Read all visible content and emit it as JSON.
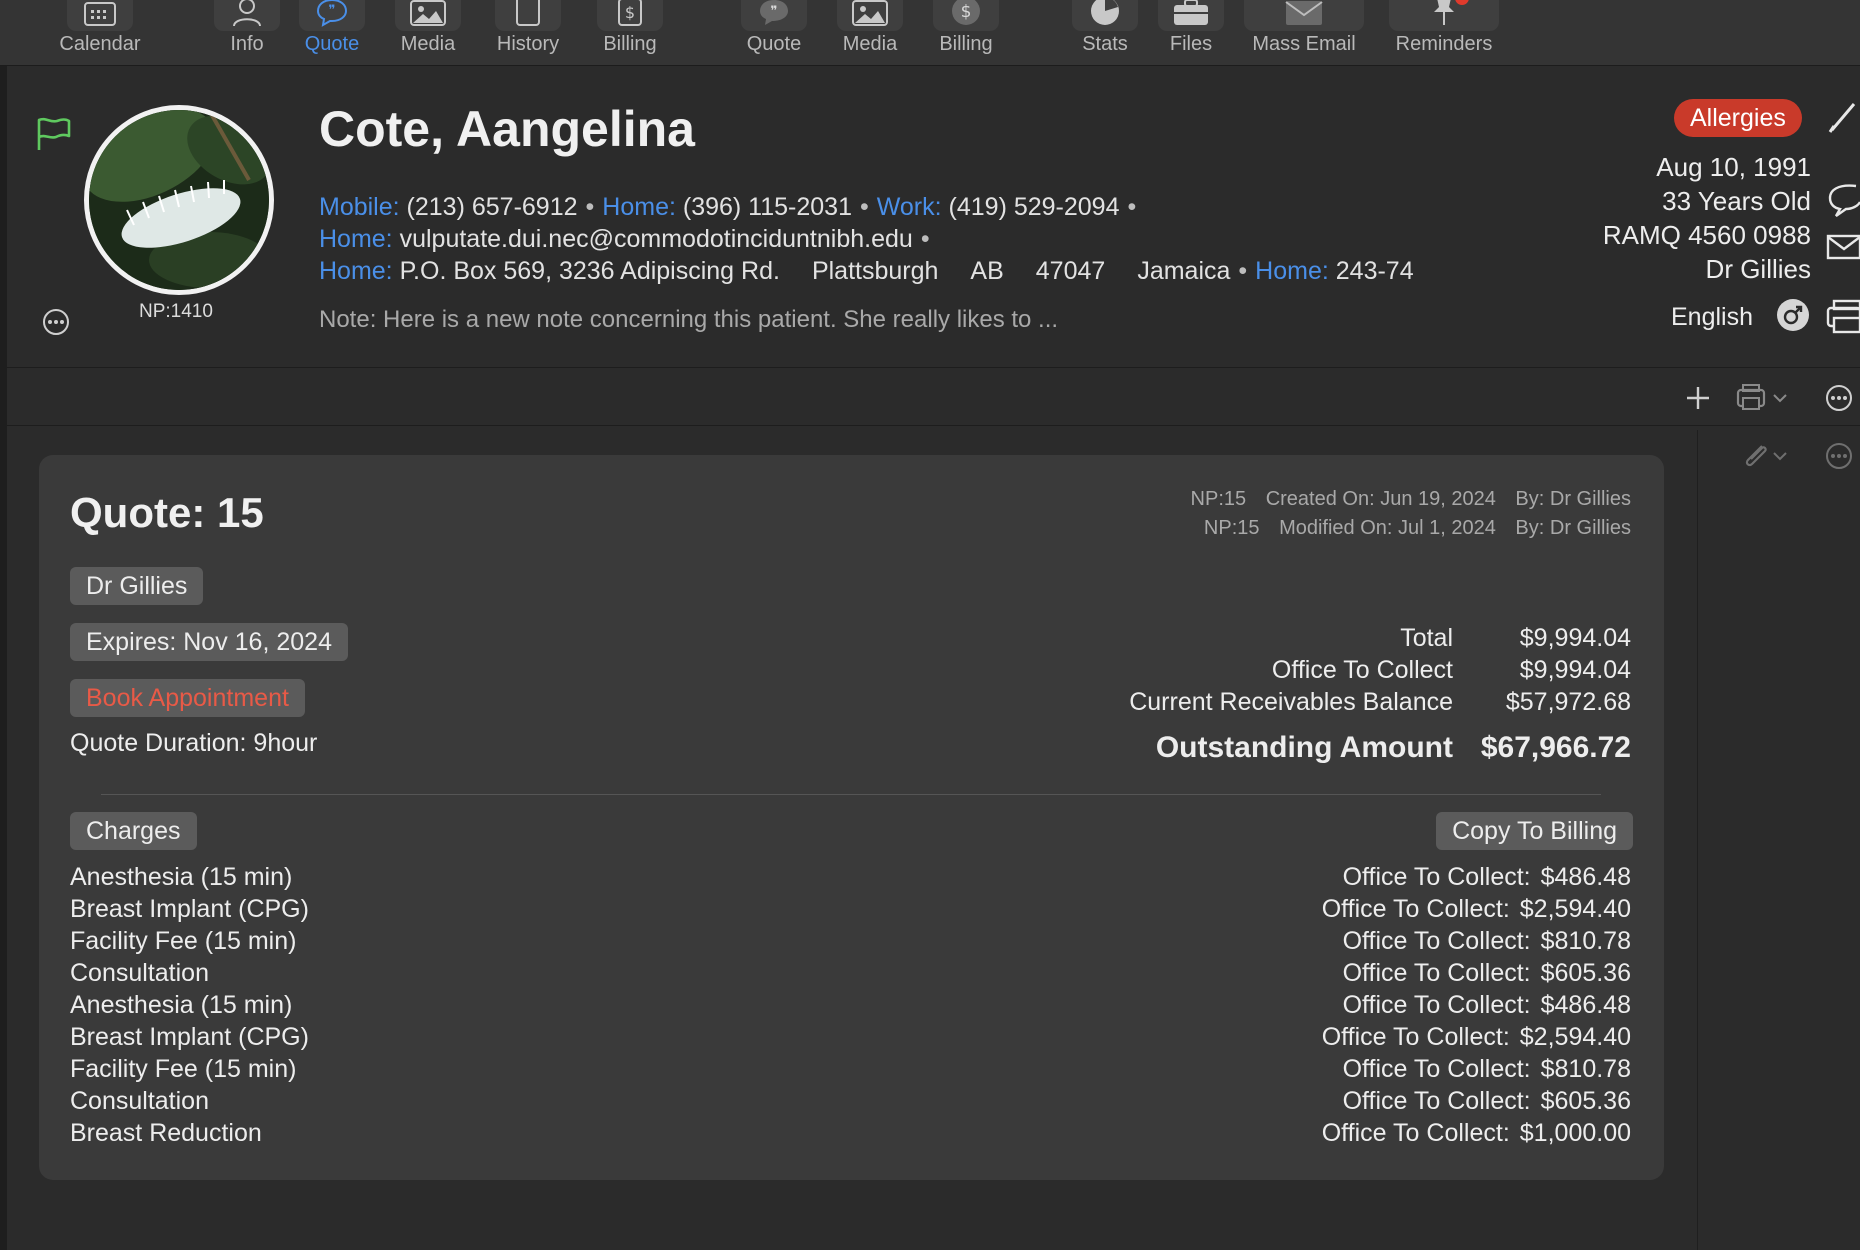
{
  "toolbar": {
    "items": [
      {
        "label": "Calendar",
        "icon": "calendar-icon"
      },
      {
        "label": "Info",
        "icon": "person-icon"
      },
      {
        "label": "Quote",
        "icon": "quote-icon",
        "active": true
      },
      {
        "label": "Media",
        "icon": "photo-icon"
      },
      {
        "label": "History",
        "icon": "history-icon"
      },
      {
        "label": "Billing",
        "icon": "dollar-doc-icon"
      },
      {
        "label": "Quote",
        "icon": "quote-bubble-icon"
      },
      {
        "label": "Media",
        "icon": "photo-icon"
      },
      {
        "label": "Billing",
        "icon": "dollar-circle-icon"
      },
      {
        "label": "Stats",
        "icon": "pie-chart-icon"
      },
      {
        "label": "Files",
        "icon": "briefcase-icon"
      },
      {
        "label": "Mass Email",
        "icon": "envelope-icon"
      },
      {
        "label": "Reminders",
        "icon": "pin-icon"
      }
    ]
  },
  "patient": {
    "name": "Cote, Aangelina",
    "np": "NP:1410",
    "mobile_label": "Mobile:",
    "mobile": "(213) 657-6912",
    "home_label": "Home:",
    "home_phone": "(396) 115-2031",
    "work_label": "Work:",
    "work_phone": "(419) 529-2094",
    "email_label": "Home:",
    "email": "vulputate.dui.nec@commodotinciduntnibh.edu",
    "address_label": "Home:",
    "address_street": "P.O. Box 569, 3236 Adipiscing Rd.",
    "address_city": "Plattsburgh",
    "address_region": "AB",
    "address_zip": "47047",
    "address_country": "Jamaica",
    "extra_label": "Home:",
    "extra_phone": "243-74",
    "bullet": "•",
    "note": "Note: Here is a new note concerning this patient. She really likes to ...",
    "allergies": "Allergies",
    "dob": "Aug 10, 1991",
    "age": "33 Years Old",
    "ramq": "RAMQ 4560 0988",
    "doctor": "Dr Gillies",
    "language": "English"
  },
  "quote": {
    "title": "Quote: 15",
    "meta_created_np": "NP:15",
    "meta_created": "Created On: Jun 19, 2024",
    "meta_created_by": "By: Dr Gillies",
    "meta_modified_np": "NP:15",
    "meta_modified": "Modified On: Jul 1, 2024",
    "meta_modified_by": "By: Dr Gillies",
    "doctor": "Dr Gillies",
    "expires": "Expires: Nov 16, 2024",
    "book": "Book Appointment",
    "duration": "Quote Duration: 9hour",
    "totals": [
      {
        "label": "Total",
        "value": "$9,994.04"
      },
      {
        "label": "Office To Collect",
        "value": "$9,994.04"
      },
      {
        "label": "Current Receivables Balance",
        "value": "$57,972.68"
      }
    ],
    "outstanding_label": "Outstanding Amount",
    "outstanding_value": "$67,966.72",
    "charges_button": "Charges",
    "copy_button": "Copy To Billing",
    "collect_label": "Office To Collect:",
    "charges": [
      {
        "name": "Anesthesia (15 min)",
        "amount": "$486.48"
      },
      {
        "name": "Breast Implant (CPG)",
        "amount": "$2,594.40"
      },
      {
        "name": "Facility Fee (15 min)",
        "amount": "$810.78"
      },
      {
        "name": "Consultation",
        "amount": "$605.36"
      },
      {
        "name": "Anesthesia (15 min)",
        "amount": "$486.48"
      },
      {
        "name": "Breast Implant (CPG)",
        "amount": "$2,594.40"
      },
      {
        "name": "Facility Fee (15 min)",
        "amount": "$810.78"
      },
      {
        "name": "Consultation",
        "amount": "$605.36"
      },
      {
        "name": "Breast Reduction",
        "amount": "$1,000.00"
      }
    ]
  },
  "colors": {
    "accent": "#4a8fe8",
    "allergy": "#c93a2a",
    "book": "#e85a47",
    "background": "#2b2b2b",
    "card": "#3a3a3a"
  }
}
